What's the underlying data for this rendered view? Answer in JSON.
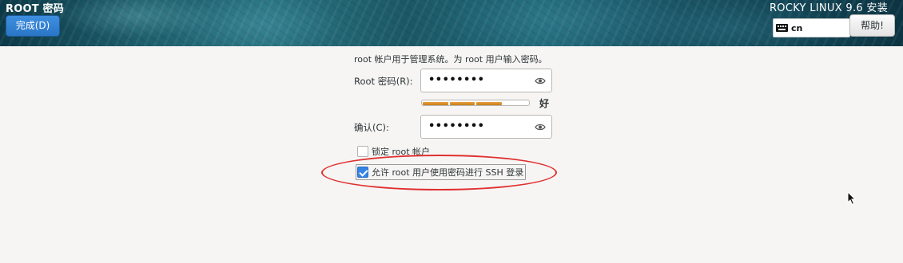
{
  "header": {
    "screen_title": "ROOT 密码",
    "done_button": "完成(D)",
    "product_title": "ROCKY LINUX 9.6 安装",
    "keyboard_layout": "cn",
    "help_button": "帮助!"
  },
  "form": {
    "intro": "root 帐户用于管理系统。为 root 用户输入密码。",
    "password_label": "Root 密码(R):",
    "password_value": "••••••••",
    "strength_fraction": 0.75,
    "strength_label": "好",
    "confirm_label": "确认(C):",
    "confirm_value": "••••••••",
    "lock_root": {
      "label": "锁定 root 帐户",
      "checked": false
    },
    "allow_ssh": {
      "label": "允许 root 用户使用密码进行 SSH 登录",
      "checked": true
    }
  },
  "icons": [
    "keyboard-icon",
    "eye-icon",
    "mouse-cursor-icon"
  ],
  "colors": {
    "accent": "#3584e4",
    "strength": "#e09a34",
    "annotation": "#e03030"
  }
}
